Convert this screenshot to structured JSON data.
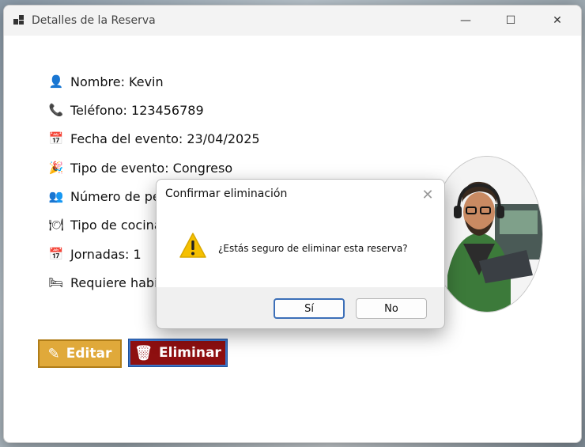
{
  "window": {
    "title": "Detalles de la Reserva",
    "minimize": "—",
    "maximize": "☐",
    "close": "✕"
  },
  "details": [
    {
      "icon": "person-icon",
      "glyph": "👤",
      "text": "Nombre: Kevin"
    },
    {
      "icon": "phone-icon",
      "glyph": "📞",
      "text": "Teléfono: 123456789"
    },
    {
      "icon": "calendar-icon",
      "glyph": "📅",
      "text": "Fecha del evento: 23/04/2025"
    },
    {
      "icon": "confetti-icon",
      "glyph": "🎉",
      "text": "Tipo de evento: Congreso"
    },
    {
      "icon": "people-icon",
      "glyph": "👥",
      "text": "Número de pe"
    },
    {
      "icon": "dish-icon",
      "glyph": "🍽",
      "text": "Tipo de cocina"
    },
    {
      "icon": "calendar-icon",
      "glyph": "📅",
      "text": "Jornadas: 1"
    },
    {
      "icon": "bed-icon",
      "glyph": "🛏",
      "text": "Requiere habit"
    }
  ],
  "buttons": {
    "edit_label": "Editar",
    "delete_label": "Eliminar"
  },
  "dialog": {
    "title": "Confirmar eliminación",
    "message": "¿Estás seguro de eliminar esta reserva?",
    "yes_label": "Sí",
    "no_label": "No",
    "close": "✕"
  },
  "colors": {
    "edit_button": "#e0a93a",
    "delete_button": "#8e0f10",
    "accent_focus": "#3c6fb8",
    "warning": "#f5c000"
  }
}
